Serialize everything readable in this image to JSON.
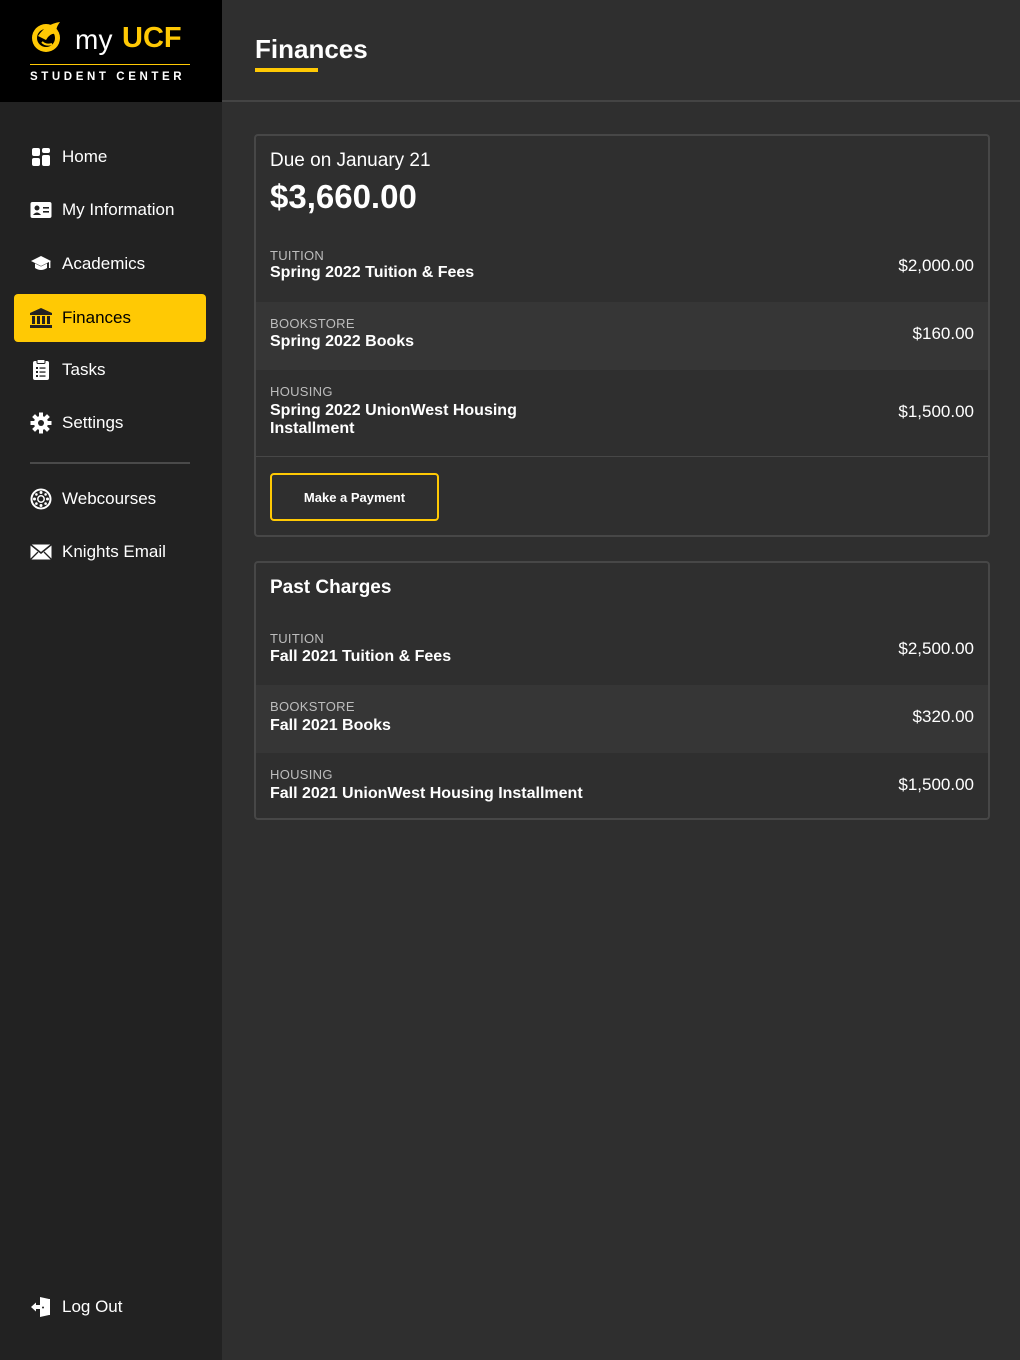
{
  "brand": {
    "my": "my",
    "ucf": "UCF",
    "subtitle": "STUDENT CENTER",
    "accent": "#ffc904"
  },
  "sidebar": {
    "items": [
      {
        "label": "Home",
        "icon": "home-grid-icon"
      },
      {
        "label": "My Information",
        "icon": "id-card-icon"
      },
      {
        "label": "Academics",
        "icon": "graduation-cap-icon"
      },
      {
        "label": "Finances",
        "icon": "bank-icon",
        "active": true
      },
      {
        "label": "Tasks",
        "icon": "clipboard-icon"
      },
      {
        "label": "Settings",
        "icon": "gear-icon"
      }
    ],
    "external": [
      {
        "label": "Webcourses",
        "icon": "canvas-logo-icon"
      },
      {
        "label": "Knights Email",
        "icon": "envelope-icon"
      }
    ],
    "logout": {
      "label": "Log Out",
      "icon": "logout-icon"
    }
  },
  "header": {
    "title": "Finances"
  },
  "due": {
    "label": "Due on January 21",
    "amount": "$3,660.00",
    "items": [
      {
        "category": "TUITION",
        "name": "Spring 2022 Tuition & Fees",
        "amount": "$2,000.00"
      },
      {
        "category": "BOOKSTORE",
        "name": "Spring 2022 Books",
        "amount": "$160.00"
      },
      {
        "category": "HOUSING",
        "name": "Spring 2022 UnionWest Housing Installment",
        "amount": "$1,500.00"
      }
    ],
    "pay_button": "Make a Payment"
  },
  "past": {
    "title": "Past Charges",
    "items": [
      {
        "category": "TUITION",
        "name": "Fall 2021 Tuition & Fees",
        "amount": "$2,500.00"
      },
      {
        "category": "BOOKSTORE",
        "name": "Fall 2021 Books",
        "amount": "$320.00"
      },
      {
        "category": "HOUSING",
        "name": "Fall 2021 UnionWest Housing Installment",
        "amount": "$1,500.00"
      }
    ]
  }
}
